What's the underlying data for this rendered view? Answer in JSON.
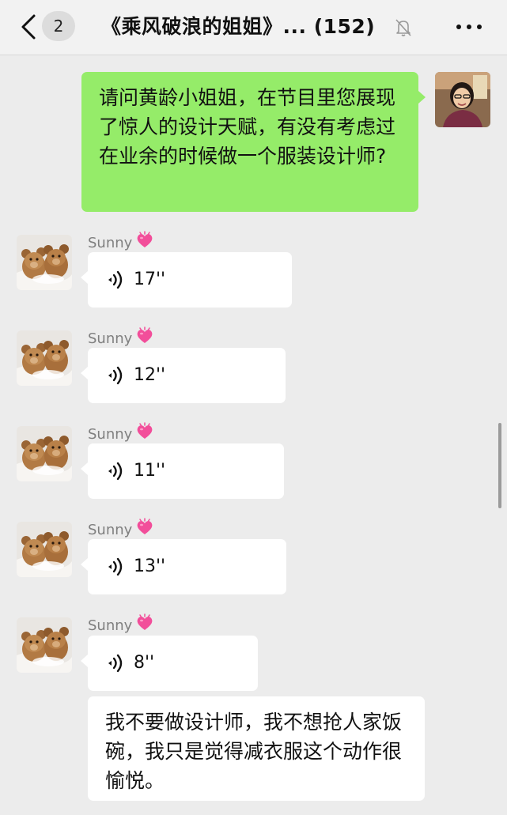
{
  "header": {
    "unread_count": "2",
    "title": "《乘风破浪的姐姐》... (152)"
  },
  "messages": [
    {
      "type": "text",
      "from": "self",
      "text": "请问黄龄小姐姐，在节目里您展现了惊人的设计天赋，有没有考虑过在业余的时候做一个服装设计师?"
    },
    {
      "type": "voice",
      "sender": "Sunny",
      "duration": "17''"
    },
    {
      "type": "voice",
      "sender": "Sunny",
      "duration": "12''"
    },
    {
      "type": "voice",
      "sender": "Sunny",
      "duration": "11''"
    },
    {
      "type": "voice",
      "sender": "Sunny",
      "duration": "13''"
    },
    {
      "type": "voice",
      "sender": "Sunny",
      "duration": "8''"
    },
    {
      "type": "text",
      "from": "Sunny",
      "text": "我不要做设计师，我不想抢人家饭碗，我只是觉得减衣服这个动作很愉悦。"
    }
  ],
  "icons": {
    "back": "chevron-left-icon",
    "mute": "bell-slash-icon",
    "more": "ellipsis-icon",
    "voice": "voice-wave-icon",
    "name_emoji": "heart-emoji-icon"
  },
  "colors": {
    "chat_background": "#ececec",
    "my_bubble": "#95ec69",
    "other_bubble": "#ffffff",
    "header_background": "#f2f2f2",
    "sender_name": "#7f7f7f"
  }
}
